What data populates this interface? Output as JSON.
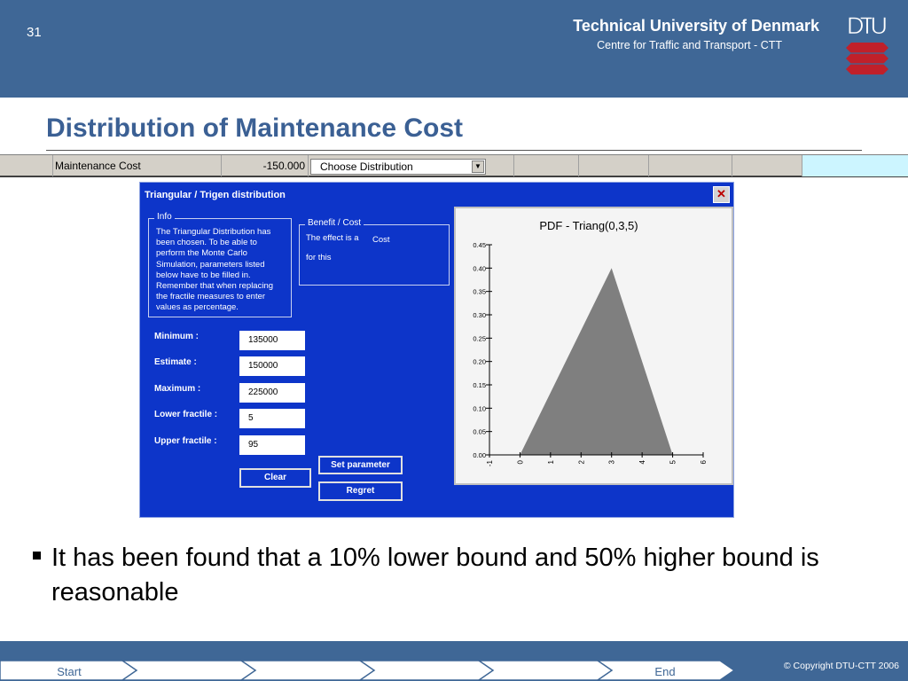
{
  "slide": {
    "number": "31"
  },
  "header": {
    "university": "Technical University of Denmark",
    "centre": "Centre for Traffic and Transport - CTT",
    "logo_text": "DTU"
  },
  "title": "Distribution of Maintenance Cost",
  "spreadsheet": {
    "label": "Maintenance Cost",
    "value": "-150.000",
    "dropdown_selected": "Choose Distribution"
  },
  "dialog": {
    "title": "Triangular / Trigen distribution",
    "close_label": "✕",
    "info": {
      "legend": "Info",
      "lines": [
        "The Triangular Distribution has",
        "been chosen. To be able to",
        "perform the Monte Carlo",
        "Simulation, parameters listed",
        "below have to be filled in.",
        "Remember that when replacing",
        "the fractile measures to enter",
        "values as percentage."
      ]
    },
    "benefit_cost": {
      "legend": "Benefit / Cost",
      "line1": "The effect is a",
      "value": "Cost",
      "line2": "for this"
    },
    "fields": [
      {
        "label": "Minimum :",
        "value": "135000"
      },
      {
        "label": "Estimate :",
        "value": "150000"
      },
      {
        "label": "Maximum :",
        "value": "225000"
      },
      {
        "label": "Lower fractile :",
        "value": "5"
      },
      {
        "label": "Upper fractile :",
        "value": "95"
      }
    ],
    "buttons": {
      "set_parameter": "Set parameter",
      "clear": "Clear",
      "regret": "Regret"
    }
  },
  "chart_data": {
    "type": "area",
    "title": "PDF - Triang(0,3,5)",
    "x": [
      0,
      3,
      5
    ],
    "y": [
      0,
      0.4,
      0
    ],
    "xlim": [
      -1,
      6
    ],
    "ylim": [
      0,
      0.45
    ],
    "x_ticks": [
      "-1",
      "0",
      "1",
      "2",
      "3",
      "4",
      "5",
      "6"
    ],
    "y_ticks": [
      "0.00",
      "0.05",
      "0.10",
      "0.15",
      "0.20",
      "0.25",
      "0.30",
      "0.35",
      "0.40",
      "0.45"
    ],
    "fill_color": "#7f7f7f",
    "grid": false
  },
  "bullet": "It has been found that a 10% lower bound and 50% higher bound is reasonable",
  "footer": {
    "start": "Start",
    "end": "End",
    "copyright": "© Copyright DTU-CTT 2006"
  },
  "colors": {
    "header_band": "#3f6796",
    "title": "#3b6094",
    "dialog_bg": "#0d35c9",
    "logo_red": "#c0202a"
  }
}
